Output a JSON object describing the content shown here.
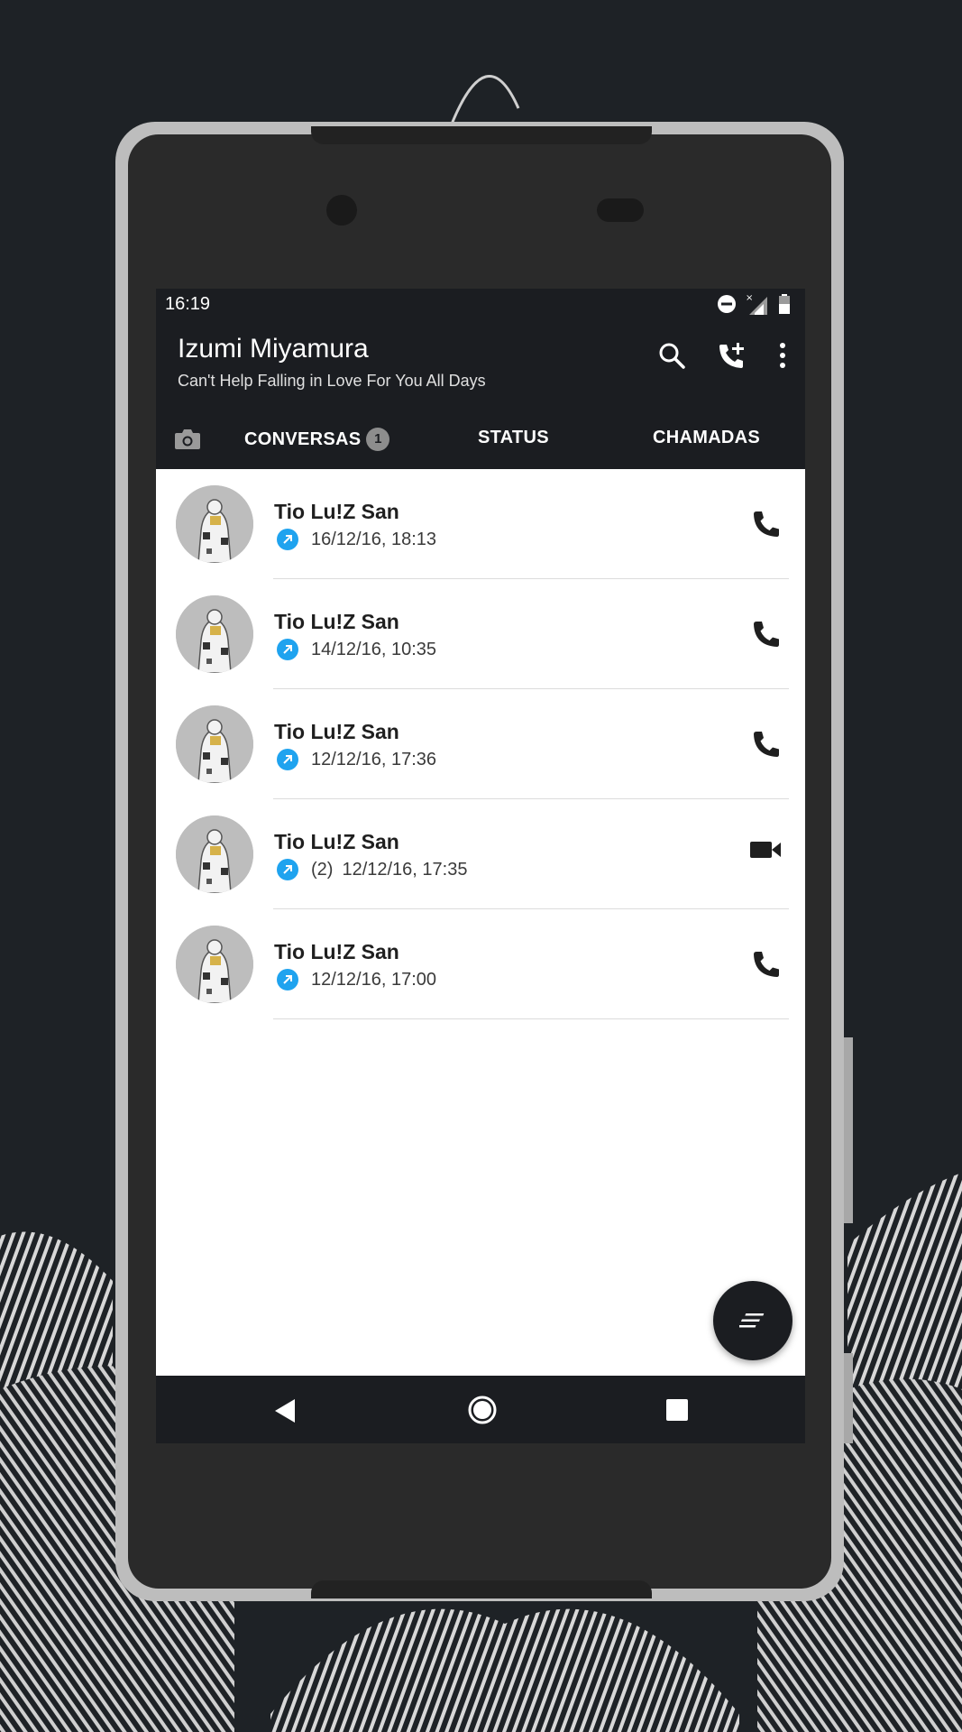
{
  "status_bar": {
    "time": "16:19"
  },
  "app_bar": {
    "title": "Izumi Miyamura",
    "subtitle": "Can't Help Falling in Love For You All Days"
  },
  "tabs": [
    {
      "label": "CONVERSAS",
      "badge": "1"
    },
    {
      "label": "STATUS"
    },
    {
      "label": "CHAMADAS",
      "active": true
    }
  ],
  "calls": [
    {
      "name": "Tio Lu!Z San",
      "direction": "outgoing",
      "count": "",
      "time": "16/12/16, 18:13",
      "type": "voice"
    },
    {
      "name": "Tio Lu!Z San",
      "direction": "outgoing",
      "count": "",
      "time": "14/12/16, 10:35",
      "type": "voice"
    },
    {
      "name": "Tio Lu!Z San",
      "direction": "outgoing",
      "count": "",
      "time": "12/12/16, 17:36",
      "type": "voice"
    },
    {
      "name": "Tio Lu!Z San",
      "direction": "outgoing",
      "count": "(2)",
      "time": "12/12/16, 17:35",
      "type": "video"
    },
    {
      "name": "Tio Lu!Z San",
      "direction": "outgoing",
      "count": "",
      "time": "12/12/16, 17:00",
      "type": "voice"
    }
  ],
  "colors": {
    "app_bar": "#1b1d21",
    "outgoing_arrow": "#1fa3ef",
    "background": "#1e2226"
  }
}
